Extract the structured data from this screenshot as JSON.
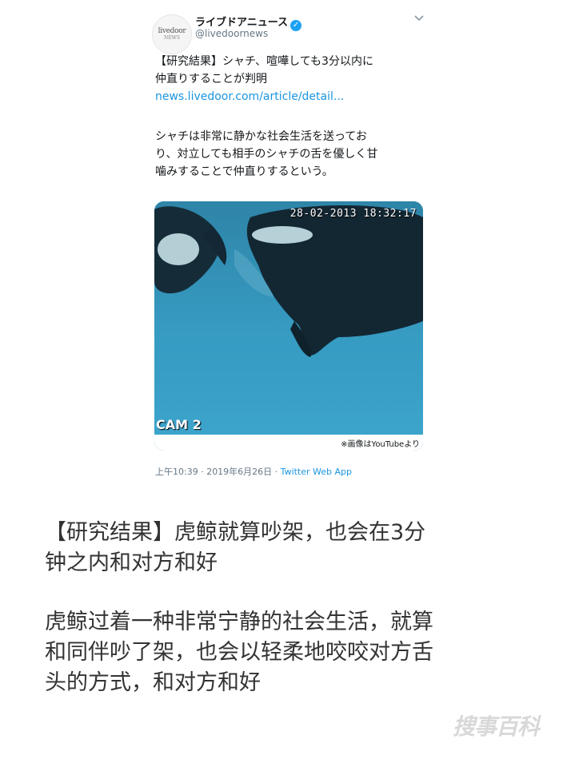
{
  "tweet": {
    "avatar": {
      "line1": "livedoor",
      "line2": "NEWS"
    },
    "display_name": "ライブドアニュース",
    "handle": "@livedoornews",
    "headline_line1": "【研究結果】シャチ、喧嘩しても3分以内に",
    "headline_line2": "仲直りすることが判明",
    "link": "news.livedoor.com/article/detail...",
    "body_line1": "シャチは非常に静かな社会生活を送ってお",
    "body_line2": "り、対立しても相手のシャチの舌を優しく甘",
    "body_line3": "噛みすることで仲直りするという。",
    "media": {
      "timestamp": "28-02-2013 18:32:17",
      "cam_label": "CAM 2",
      "credit": "※画像はYouTubeより"
    },
    "meta": {
      "time_date": "上午10:39 · 2019年6月26日 · ",
      "app": "Twitter Web App"
    },
    "colors": {
      "link": "#1b95e0",
      "verified": "#1da1f2",
      "muted": "#657786"
    }
  },
  "article": {
    "title_line1": "【研究结果】虎鲸就算吵架，也会在3分",
    "title_line2": "钟之内和对方和好",
    "body_line1": "虎鲸过着一种非常宁静的社会生活，就算",
    "body_line2": "和同伴吵了架，也会以轻柔地咬咬对方舌",
    "body_line3": "头的方式，和对方和好"
  },
  "watermark": "搜事百科"
}
